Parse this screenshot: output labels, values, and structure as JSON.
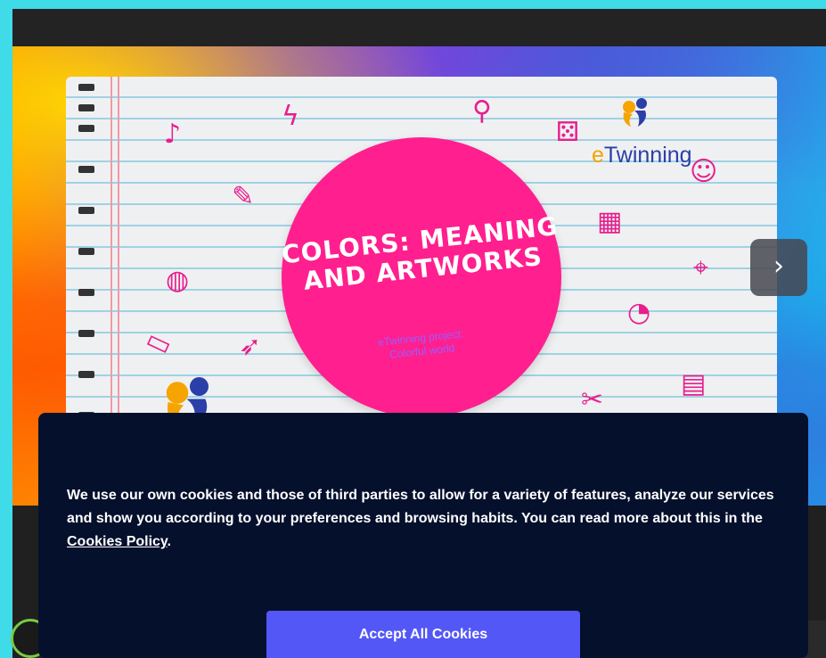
{
  "hero": {
    "title": "COLORS: MEANING AND ARTWORKS",
    "subtitle_line1": "eTwinning project:",
    "subtitle_line2": "Colorful world",
    "logo_text_e": "e",
    "logo_text_rest": "Twinning",
    "next_label": "›"
  },
  "cookie_banner": {
    "text_before_link": "We use our own cookies and those of third parties to allow for a variety of features, analyze our services and show you according to your preferences and browsing habits. You can read more about this in the ",
    "link_label": "Cookies Policy",
    "text_after_link": ".",
    "accept_label": "Accept All Cookies"
  },
  "colors": {
    "frame_border": "#40dbe8",
    "circle": "#ff1f8f",
    "banner_bg": "#05112c",
    "accept_button": "#5357f5"
  },
  "icons": [
    "guitar-icon",
    "lightning-icon",
    "pushpin-icon",
    "dice-icon",
    "pencil-icon",
    "map-icon",
    "globe-icon",
    "palette-icon",
    "ruler-icon",
    "cursor-icon",
    "scissors-icon",
    "notebook-icon",
    "chevron-right-icon"
  ]
}
